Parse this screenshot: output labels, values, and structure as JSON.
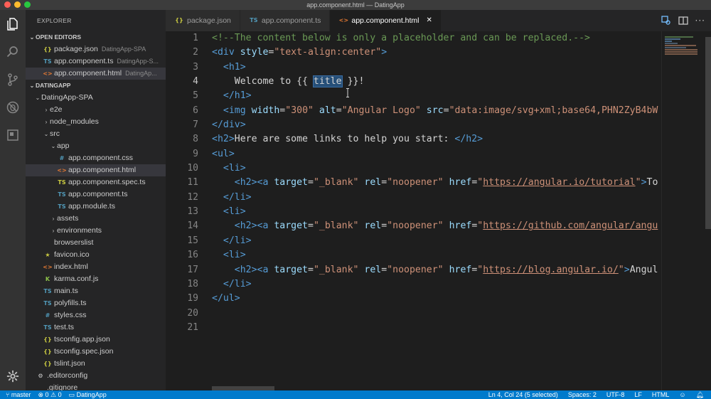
{
  "window": {
    "title": "app.component.html — DatingApp"
  },
  "explorer": {
    "title": "EXPLORER",
    "open_editors": {
      "header": "OPEN EDITORS",
      "items": [
        {
          "icon": "braces",
          "name": "package.json",
          "folder": "DatingApp-SPA"
        },
        {
          "icon": "ts",
          "name": "app.component.ts",
          "folder": "DatingApp-S..."
        },
        {
          "icon": "html",
          "name": "app.component.html",
          "folder": "DatingAp..."
        }
      ]
    },
    "project": {
      "header": "DATINGAPP",
      "items": [
        {
          "name": "DatingApp-SPA",
          "chev": "⌄",
          "icon": ""
        },
        {
          "name": "e2e",
          "chev": "›",
          "icon": ""
        },
        {
          "name": "node_modules",
          "chev": "›",
          "icon": ""
        },
        {
          "name": "src",
          "chev": "⌄",
          "icon": ""
        },
        {
          "name": "app",
          "chev": "⌄",
          "icon": ""
        },
        {
          "name": "app.component.css",
          "chev": "",
          "icon": "css"
        },
        {
          "name": "app.component.html",
          "chev": "",
          "icon": "html"
        },
        {
          "name": "app.component.spec.ts",
          "chev": "",
          "icon": "tstest"
        },
        {
          "name": "app.component.ts",
          "chev": "",
          "icon": "ts"
        },
        {
          "name": "app.module.ts",
          "chev": "",
          "icon": "ts"
        },
        {
          "name": "assets",
          "chev": "›",
          "icon": ""
        },
        {
          "name": "environments",
          "chev": "›",
          "icon": ""
        },
        {
          "name": "browserslist",
          "chev": "",
          "icon": ""
        },
        {
          "name": "favicon.ico",
          "chev": "",
          "icon": "star"
        },
        {
          "name": "index.html",
          "chev": "",
          "icon": "html"
        },
        {
          "name": "karma.conf.js",
          "chev": "",
          "icon": "karma"
        },
        {
          "name": "main.ts",
          "chev": "",
          "icon": "ts"
        },
        {
          "name": "polyfills.ts",
          "chev": "",
          "icon": "ts"
        },
        {
          "name": "styles.css",
          "chev": "",
          "icon": "css"
        },
        {
          "name": "test.ts",
          "chev": "",
          "icon": "ts"
        },
        {
          "name": "tsconfig.app.json",
          "chev": "",
          "icon": "braces"
        },
        {
          "name": "tsconfig.spec.json",
          "chev": "",
          "icon": "braces"
        },
        {
          "name": "tslint.json",
          "chev": "",
          "icon": "braces"
        },
        {
          "name": ".editorconfig",
          "chev": "",
          "icon": "gear"
        },
        {
          "name": ".gitignore",
          "chev": "",
          "icon": ""
        }
      ]
    }
  },
  "tabs": [
    {
      "icon": "braces",
      "label": "package.json"
    },
    {
      "icon": "ts",
      "label": "app.component.ts"
    },
    {
      "icon": "html",
      "label": "app.component.html",
      "close": "✕"
    }
  ],
  "icons": {
    "braces": "{}",
    "ts": "TS",
    "html": "<>",
    "css": "#",
    "tstest": "TS",
    "star": "★",
    "karma": "K",
    "gear": "⚙"
  },
  "editor": {
    "line_numbers": [
      "1",
      "2",
      "3",
      "4",
      "5",
      "6",
      "7",
      "8",
      "9",
      "10",
      "11",
      "12",
      "13",
      "14",
      "15",
      "16",
      "17",
      "18",
      "19",
      "20",
      "21"
    ],
    "lines": [
      [
        [
          "cmt",
          "<!--The content below is only a placeholder and can be replaced.-->"
        ]
      ],
      [
        [
          "tag",
          "<div "
        ],
        [
          "attr",
          "style"
        ],
        [
          "txt",
          "="
        ],
        [
          "str",
          "\"text-align:center\""
        ],
        [
          "tag",
          ">"
        ]
      ],
      [
        [
          "txt",
          "  "
        ],
        [
          "tag",
          "<h1>"
        ]
      ],
      [
        [
          "txt",
          "    Welcome to {{ "
        ],
        [
          "hl",
          "title"
        ],
        [
          "txt",
          " }}!"
        ]
      ],
      [
        [
          "txt",
          "  "
        ],
        [
          "tag",
          "</h1>"
        ]
      ],
      [
        [
          "txt",
          "  "
        ],
        [
          "tag",
          "<img "
        ],
        [
          "attr",
          "width"
        ],
        [
          "txt",
          "="
        ],
        [
          "str",
          "\"300\""
        ],
        [
          "txt",
          " "
        ],
        [
          "attr",
          "alt"
        ],
        [
          "txt",
          "="
        ],
        [
          "str",
          "\"Angular Logo\""
        ],
        [
          "txt",
          " "
        ],
        [
          "attr",
          "src"
        ],
        [
          "txt",
          "="
        ],
        [
          "str",
          "\"data:image/svg+xml;base64,PHN2ZyB4bW"
        ]
      ],
      [
        [
          "tag",
          "</div>"
        ]
      ],
      [
        [
          "tag",
          "<h2>"
        ],
        [
          "txt",
          "Here are some links to help you start: "
        ],
        [
          "tag",
          "</h2>"
        ]
      ],
      [
        [
          "tag",
          "<ul>"
        ]
      ],
      [
        [
          "txt",
          "  "
        ],
        [
          "tag",
          "<li>"
        ]
      ],
      [
        [
          "txt",
          "    "
        ],
        [
          "tag",
          "<h2><a "
        ],
        [
          "attr",
          "target"
        ],
        [
          "txt",
          "="
        ],
        [
          "str",
          "\"_blank\""
        ],
        [
          "txt",
          " "
        ],
        [
          "attr",
          "rel"
        ],
        [
          "txt",
          "="
        ],
        [
          "str",
          "\"noopener\""
        ],
        [
          "txt",
          " "
        ],
        [
          "attr",
          "href"
        ],
        [
          "txt",
          "="
        ],
        [
          "str",
          "\""
        ],
        [
          "lnk",
          "https://angular.io/tutorial"
        ],
        [
          "str",
          "\""
        ],
        [
          "tag",
          ">"
        ],
        [
          "txt",
          "To"
        ]
      ],
      [
        [
          "txt",
          "  "
        ],
        [
          "tag",
          "</li>"
        ]
      ],
      [
        [
          "txt",
          "  "
        ],
        [
          "tag",
          "<li>"
        ]
      ],
      [
        [
          "txt",
          "    "
        ],
        [
          "tag",
          "<h2><a "
        ],
        [
          "attr",
          "target"
        ],
        [
          "txt",
          "="
        ],
        [
          "str",
          "\"_blank\""
        ],
        [
          "txt",
          " "
        ],
        [
          "attr",
          "rel"
        ],
        [
          "txt",
          "="
        ],
        [
          "str",
          "\"noopener\""
        ],
        [
          "txt",
          " "
        ],
        [
          "attr",
          "href"
        ],
        [
          "txt",
          "="
        ],
        [
          "str",
          "\""
        ],
        [
          "lnk",
          "https://github.com/angular/angu"
        ]
      ],
      [
        [
          "txt",
          "  "
        ],
        [
          "tag",
          "</li>"
        ]
      ],
      [
        [
          "txt",
          "  "
        ],
        [
          "tag",
          "<li>"
        ]
      ],
      [
        [
          "txt",
          "    "
        ],
        [
          "tag",
          "<h2><a "
        ],
        [
          "attr",
          "target"
        ],
        [
          "txt",
          "="
        ],
        [
          "str",
          "\"_blank\""
        ],
        [
          "txt",
          " "
        ],
        [
          "attr",
          "rel"
        ],
        [
          "txt",
          "="
        ],
        [
          "str",
          "\"noopener\""
        ],
        [
          "txt",
          " "
        ],
        [
          "attr",
          "href"
        ],
        [
          "txt",
          "="
        ],
        [
          "str",
          "\""
        ],
        [
          "lnk",
          "https://blog.angular.io/"
        ],
        [
          "str",
          "\""
        ],
        [
          "tag",
          ">"
        ],
        [
          "txt",
          "Angul"
        ]
      ],
      [
        [
          "txt",
          "  "
        ],
        [
          "tag",
          "</li>"
        ]
      ],
      [
        [
          "tag",
          "</ul>"
        ]
      ],
      [],
      []
    ],
    "current_line": 4
  },
  "status": {
    "branch": "master",
    "errors": "0",
    "warnings": "0",
    "project": "DatingApp",
    "position": "Ln 4, Col 24 (5 selected)",
    "spaces": "Spaces: 2",
    "encoding": "UTF-8",
    "eol": "LF",
    "language": "HTML"
  },
  "colors": {
    "accent": "#007acc",
    "tag": "#569cd6",
    "attr": "#9cdcfe",
    "string": "#ce9178",
    "comment": "#6a9955"
  }
}
